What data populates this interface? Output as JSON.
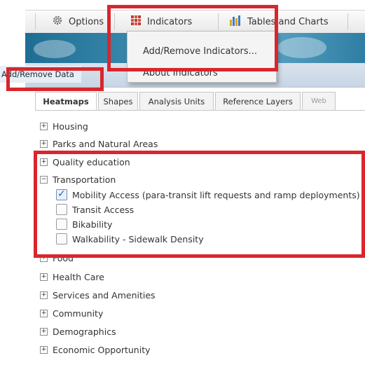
{
  "toolbar": {
    "options_label": "Options",
    "indicators_label": "Indicators",
    "tables_charts_label": "Tables and Charts"
  },
  "menu": {
    "items": [
      {
        "label": "Add/Remove Indicators..."
      },
      {
        "label": "About Indicators"
      }
    ]
  },
  "panel": {
    "title": "Add/Remove Data"
  },
  "tabs": [
    {
      "label": "Heatmaps"
    },
    {
      "label": "Shapes"
    },
    {
      "label": "Analysis Units"
    },
    {
      "label": "Reference Layers"
    },
    {
      "label": "Web"
    }
  ],
  "tree": {
    "categories": [
      {
        "label": "Housing",
        "expander": "+"
      },
      {
        "label": "Parks and Natural Areas",
        "expander": "+"
      },
      {
        "label": "Quality education",
        "expander": "+"
      },
      {
        "label": "Transportation",
        "expander": "−"
      },
      {
        "label": "Food",
        "expander": "+"
      },
      {
        "label": "Health Care",
        "expander": "+"
      },
      {
        "label": "Services and Amenities",
        "expander": "+"
      },
      {
        "label": "Community",
        "expander": "+"
      },
      {
        "label": "Demographics",
        "expander": "+"
      },
      {
        "label": "Economic Opportunity",
        "expander": "+"
      }
    ],
    "transportation_items": [
      {
        "label": "Mobility Access (para-transit lift requests and ramp deployments)",
        "checked": true
      },
      {
        "label": "Transit Access",
        "checked": false
      },
      {
        "label": "Bikability",
        "checked": false
      },
      {
        "label": "Walkability - Sidewalk Density",
        "checked": false
      }
    ]
  },
  "colors": {
    "highlight": "#d9262c",
    "banner": "#3f8fb2",
    "check": "#2a63a8"
  }
}
